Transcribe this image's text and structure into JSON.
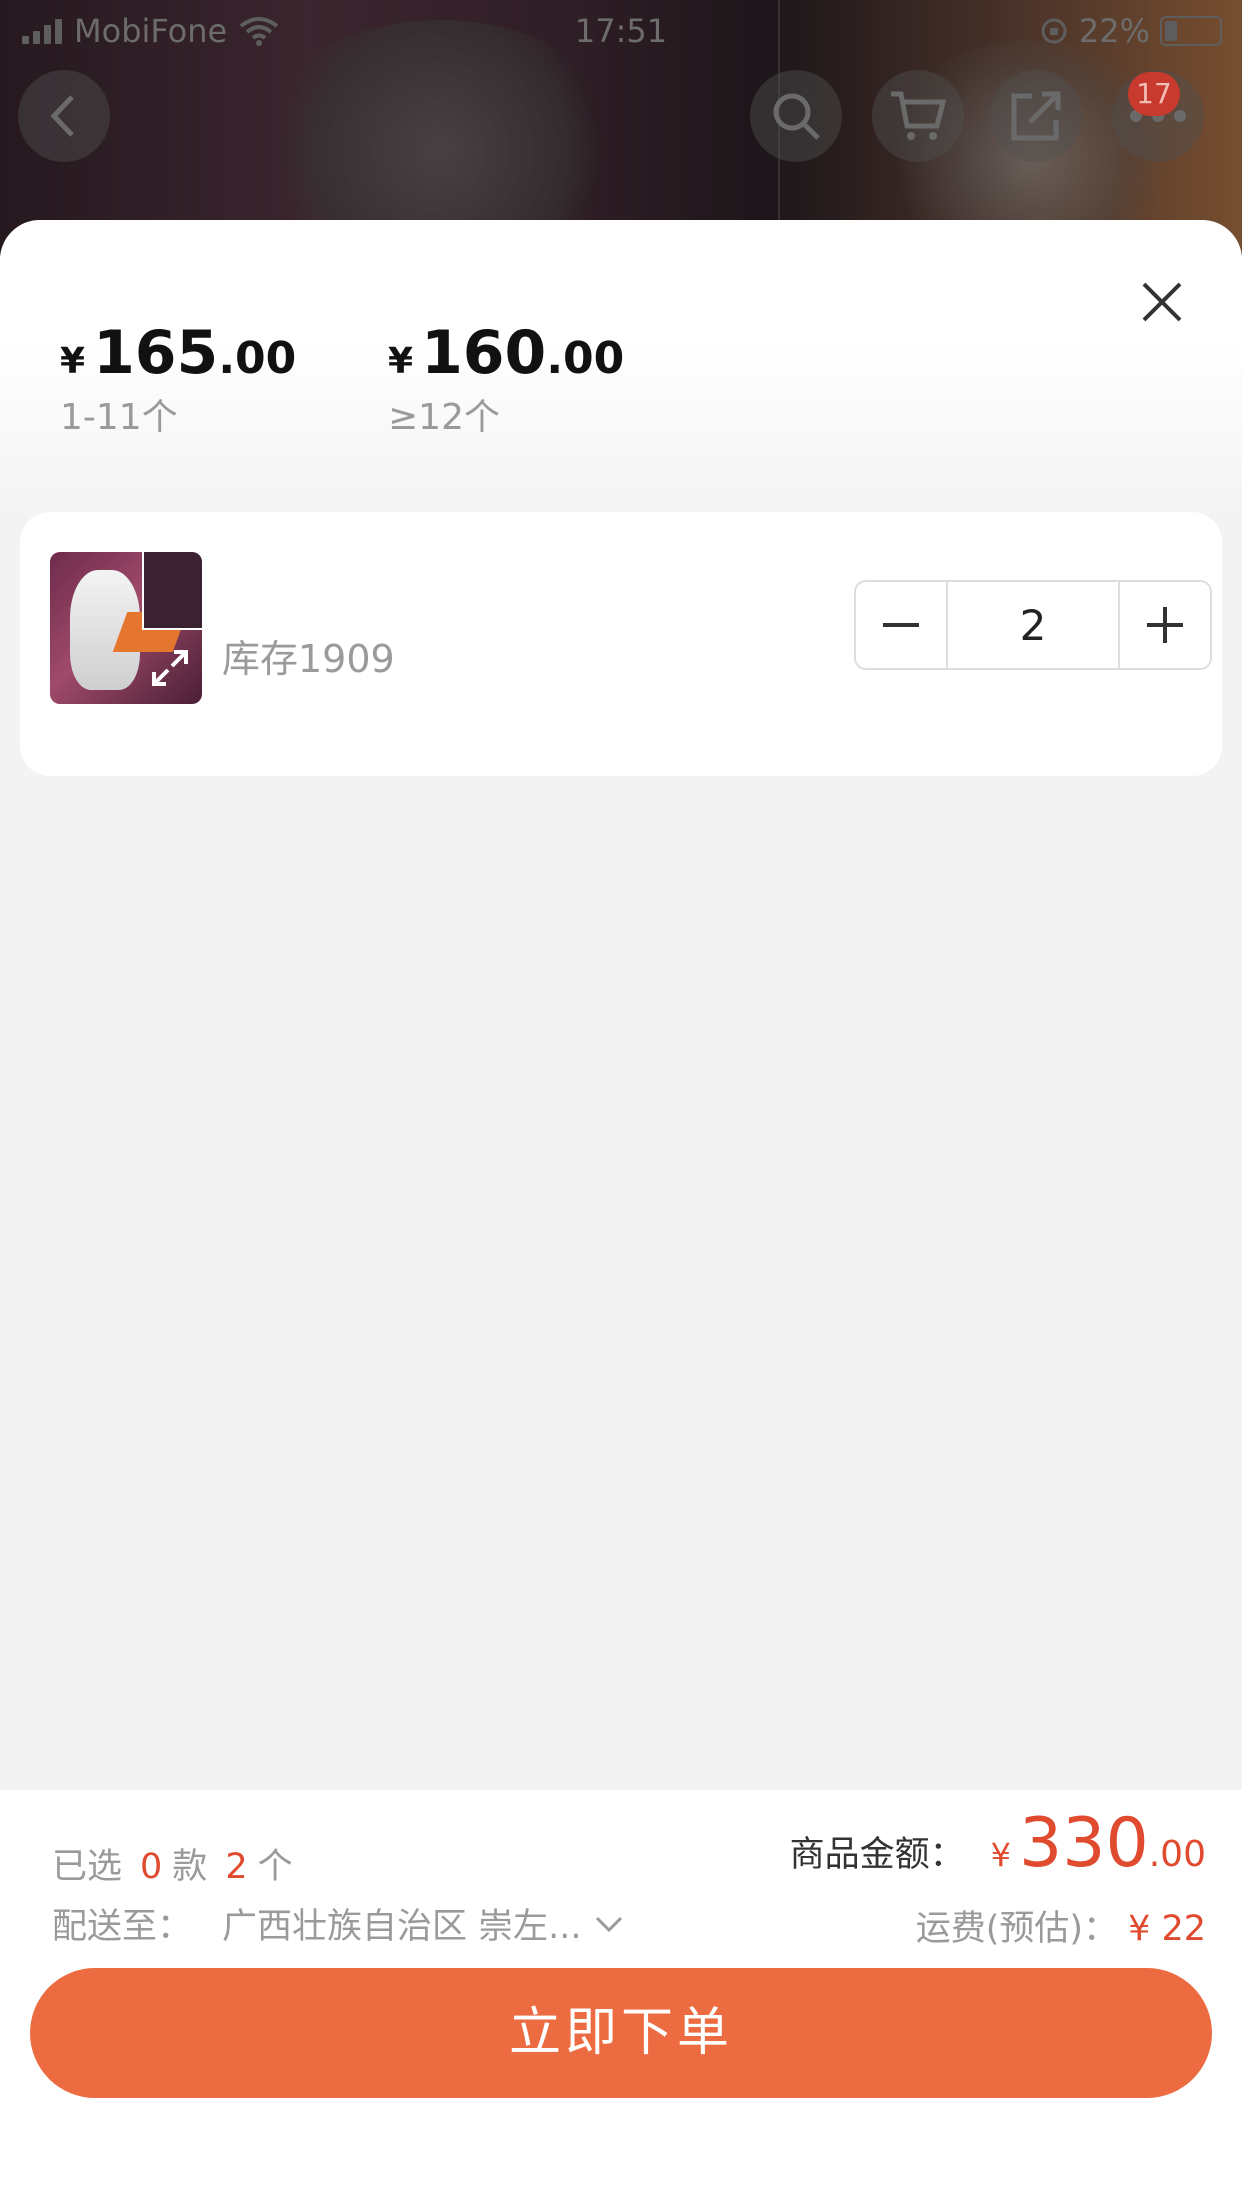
{
  "status_bar": {
    "carrier": "MobiFone",
    "time": "17:51",
    "battery": "22%"
  },
  "nav": {
    "cart_badge": "17"
  },
  "price_tiers": [
    {
      "symbol": "¥",
      "integer": "165",
      "decimal": ".00",
      "range": "1-11个"
    },
    {
      "symbol": "¥",
      "integer": "160",
      "decimal": ".00",
      "range": "≥12个"
    }
  ],
  "sku": {
    "stock": "库存1909",
    "quantity": "2"
  },
  "footer": {
    "selected_prefix": "已选",
    "selected_kinds": "0",
    "kinds_unit": "款",
    "selected_count": "2",
    "count_unit": "个",
    "ship_label": "配送至：",
    "ship_address": "广西壮族自治区 崇左...",
    "total_label": "商品金额：",
    "total_symbol": "¥",
    "total_integer": "330",
    "total_decimal": ".00",
    "freight_label": "运费(预估)：",
    "freight_value": "¥ 22",
    "submit_label": "立即下单"
  },
  "colors": {
    "accent": "#ec6b40",
    "price_red": "#e04a2f",
    "badge": "#c93a2e"
  }
}
